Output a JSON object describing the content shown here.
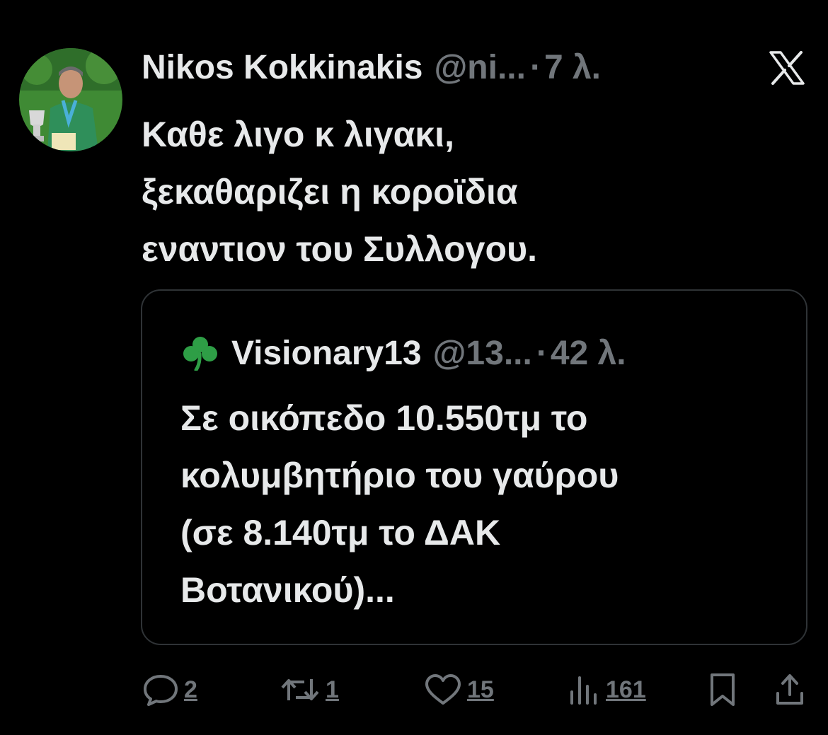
{
  "tweet": {
    "author_name": "Nikos Kokkinakis",
    "handle": "@ni...",
    "separator": "·",
    "time": "7 λ.",
    "text_lines": [
      "Καθε λιγο κ λιγακι,",
      "ξεκαθαριζει η κοροϊδια",
      "εναντιον του Συλλογου."
    ]
  },
  "quote": {
    "author_name": "Visionary13",
    "handle": "@13...",
    "separator": "·",
    "time": "42 λ.",
    "text_lines": [
      "Σε οικόπεδο 10.550τμ το",
      "κολυμβητήριο του γαύρου",
      "(σε 8.140τμ το ΔΑΚ",
      "Βοτανικού)..."
    ]
  },
  "actions": {
    "replies": "2",
    "reposts": "1",
    "likes": "15",
    "views": "161"
  },
  "colors": {
    "background": "#000000",
    "text": "#e7e9ea",
    "muted": "#71767b",
    "border": "#2f3336",
    "clover": "#2e9e46"
  }
}
